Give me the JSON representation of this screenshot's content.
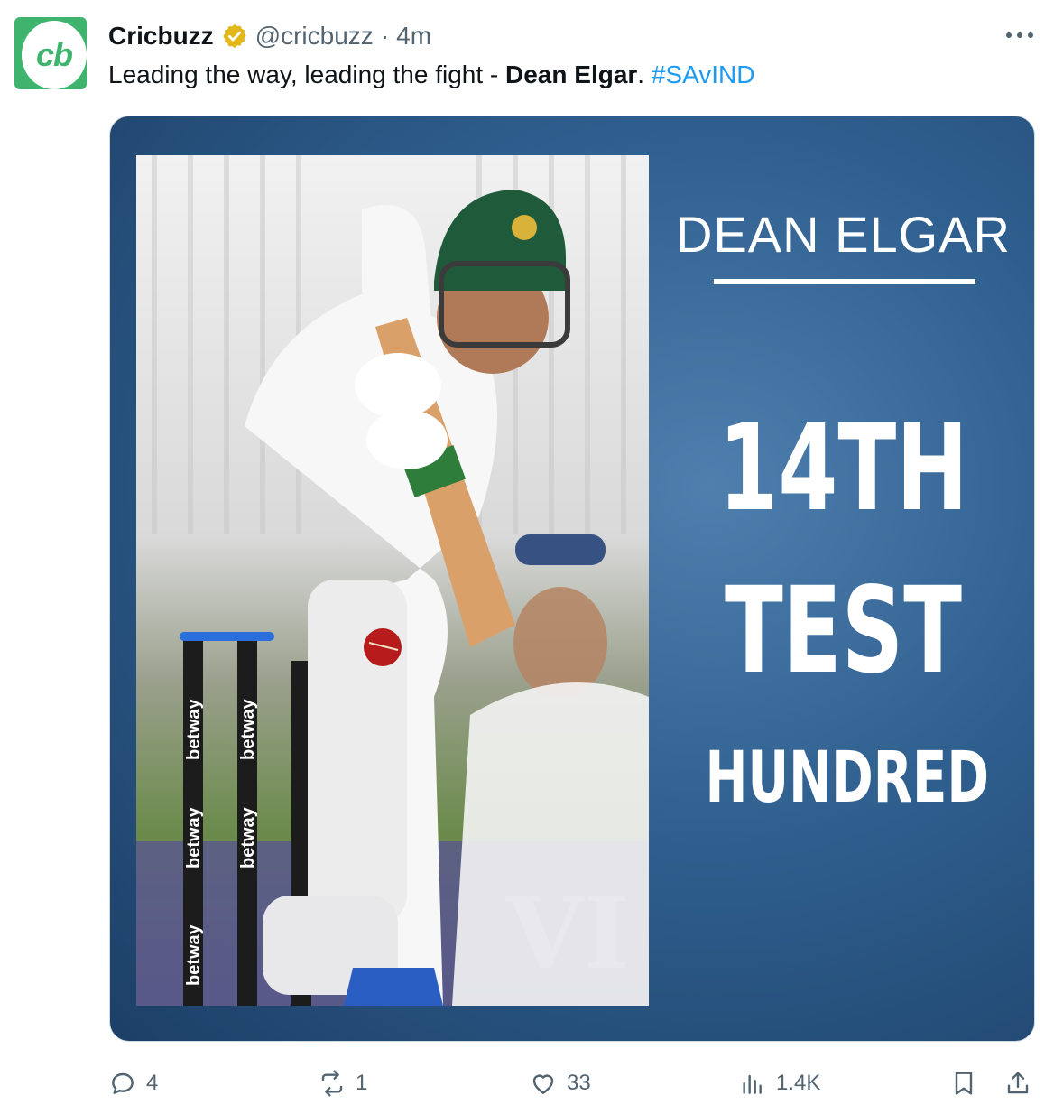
{
  "author": {
    "avatar_text": "cb",
    "name": "Cricbuzz",
    "handle": "@cricbuzz",
    "separator": "·",
    "time": "4m",
    "verified_icon": "gold-verified-badge-icon"
  },
  "tweet": {
    "text_before": "Leading the way, leading the fight - ",
    "text_bold": "Dean Elgar",
    "text_after": ". ",
    "hashtag": "#SAvIND"
  },
  "media": {
    "player_name": "DEAN ELGAR",
    "line1": "14TH",
    "line2": "TEST",
    "line3": "HUNDRED",
    "stump_sponsor": "betway",
    "colors": {
      "background": "#2f5f8f",
      "text": "#ffffff"
    }
  },
  "actions": {
    "replies": "4",
    "reposts": "1",
    "likes": "33",
    "views": "1.4K",
    "icons": [
      "reply-icon",
      "repost-icon",
      "like-icon",
      "views-icon",
      "bookmark-icon",
      "share-icon"
    ]
  },
  "colors": {
    "accent": "#1d9bf0",
    "muted": "#536471",
    "brand": "#3fb46e"
  }
}
